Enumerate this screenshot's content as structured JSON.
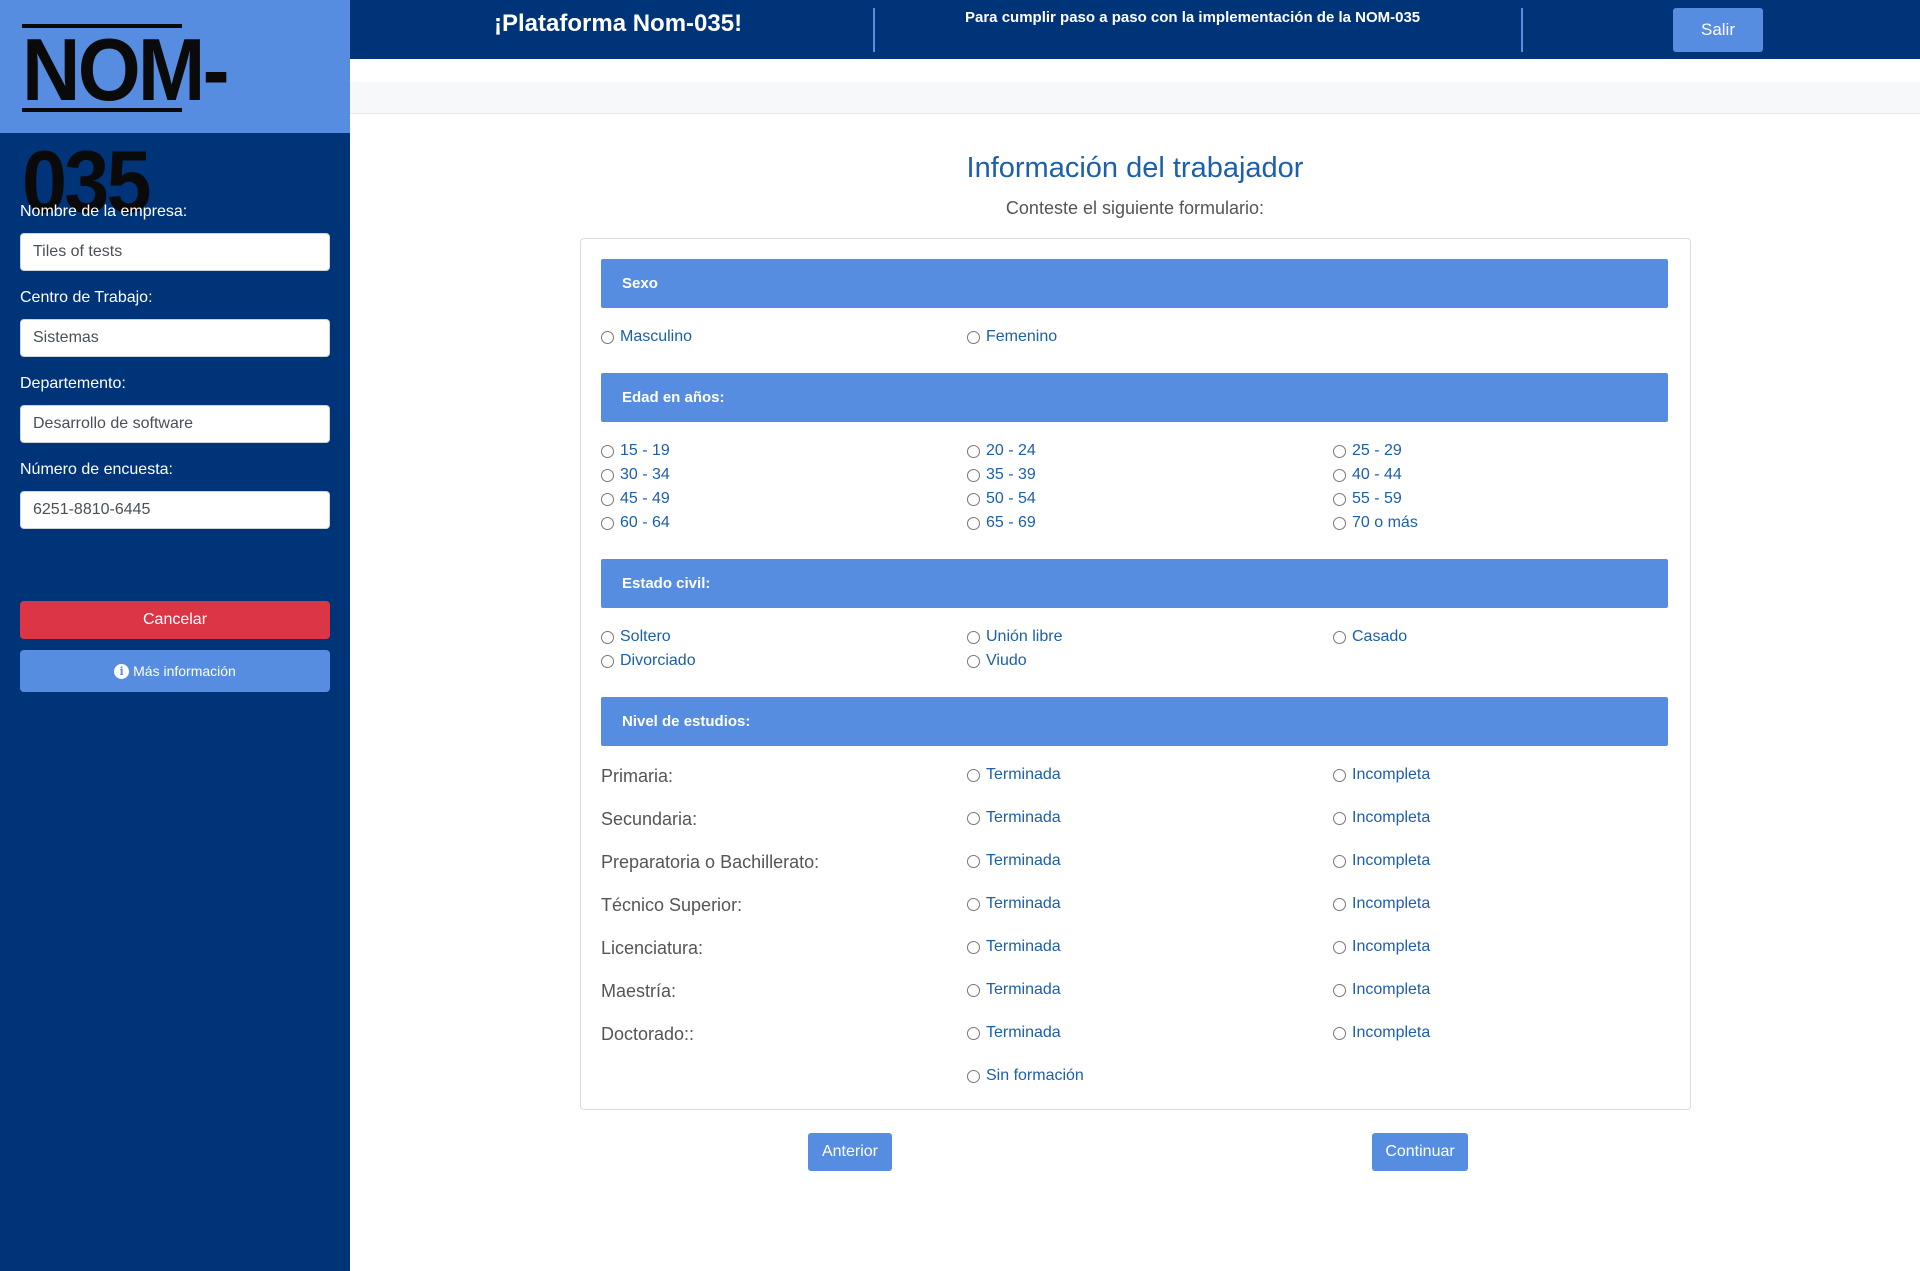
{
  "logo": {
    "text": "NOM-035"
  },
  "sidebar": {
    "fields": [
      {
        "label": "Nombre de la empresa:",
        "value": "Tiles of tests"
      },
      {
        "label": "Centro de Trabajo:",
        "value": "Sistemas"
      },
      {
        "label": "Departemento:",
        "value": "Desarrollo de software"
      },
      {
        "label": "Número de encuesta:",
        "value": "6251-8810-6445"
      }
    ],
    "cancel_label": "Cancelar",
    "info_label": "Más información",
    "info_icon": "info-circle-icon"
  },
  "header": {
    "title": "¡Plataforma Nom-035!",
    "subtitle": "Para cumplir paso a paso con la implementación de la NOM-035",
    "logout_label": "Salir"
  },
  "form": {
    "title": "Información del trabajador",
    "subtitle": "Conteste el siguiente formulario:",
    "sexo": {
      "heading": "Sexo",
      "options": [
        "Masculino",
        "Femenino"
      ]
    },
    "edad": {
      "heading": "Edad en años:",
      "options": [
        "15 - 19",
        "20 - 24",
        "25 - 29",
        "30 - 34",
        "35 - 39",
        "40 - 44",
        "45 - 49",
        "50 - 54",
        "55 - 59",
        "60 - 64",
        "65 - 69",
        "70 o más"
      ]
    },
    "estado_civil": {
      "heading": "Estado civil:",
      "options": [
        "Soltero",
        "Unión libre",
        "Casado",
        "Divorciado",
        "Viudo"
      ]
    },
    "estudios": {
      "heading": "Nivel de estudios:",
      "rows": [
        "Primaria:",
        "Secundaria:",
        "Preparatoria o Bachillerato:",
        "Técnico Superior:",
        "Licenciatura:",
        "Maestría:",
        "Doctorado::"
      ],
      "completed_label": "Terminada",
      "incomplete_label": "Incompleta",
      "none_label": "Sin formación"
    }
  },
  "nav": {
    "prev_label": "Anterior",
    "next_label": "Continuar"
  },
  "colors": {
    "navy": "#003479",
    "accent": "#568de0",
    "danger": "#dc3545",
    "title": "#1c5faa"
  }
}
